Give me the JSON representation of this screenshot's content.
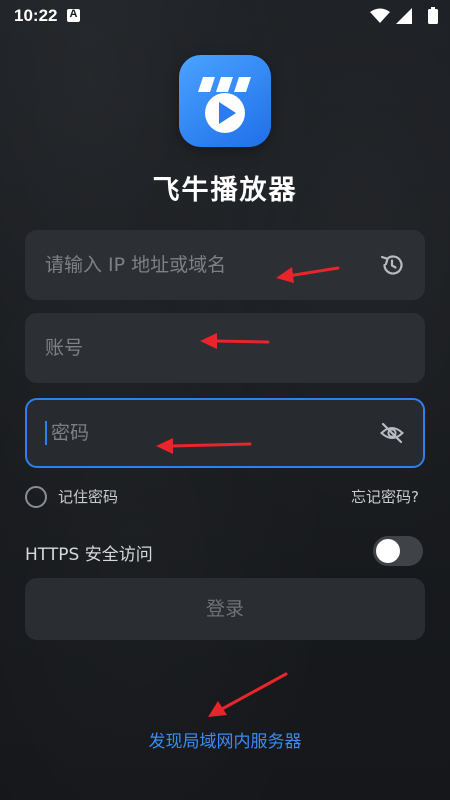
{
  "status_bar": {
    "time": "10:22",
    "notification_letter": "A"
  },
  "app": {
    "title": "飞牛播放器"
  },
  "form": {
    "server": {
      "placeholder": "请输入 IP 地址或域名",
      "value": ""
    },
    "account": {
      "placeholder": "账号",
      "value": ""
    },
    "password": {
      "placeholder": "密码",
      "value": ""
    },
    "remember_label": "记住密码",
    "remember_checked": false,
    "forgot_label": "忘记密码?",
    "https_label": "HTTPS 安全访问",
    "https_enabled": false,
    "login_label": "登录"
  },
  "discover_label": "发现局域网内服务器",
  "colors": {
    "accent": "#2f80ed",
    "link": "#3d8bf0",
    "annotation_arrow": "#e8252b"
  },
  "icons": {
    "server_field": "history-icon",
    "password_field": "eye-off-icon"
  }
}
